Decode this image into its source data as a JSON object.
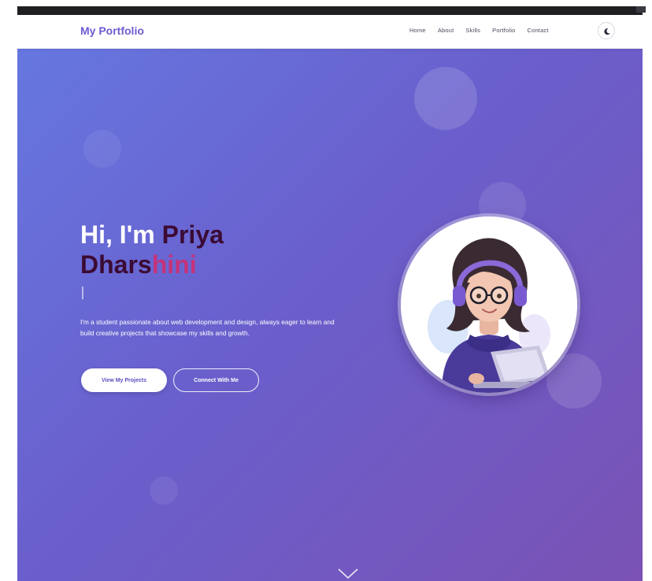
{
  "nav": {
    "brand": "My Portfolio",
    "links": [
      "Home",
      "About",
      "Skills",
      "Portfolio",
      "Contact"
    ],
    "theme_toggle_icon": "moon-icon"
  },
  "hero": {
    "greeting": "Hi, I'm ",
    "name_part1": "Priya",
    "name_part2": "Dhars",
    "name_part3": "hini",
    "description": "I'm a student passionate about web development and design, always eager to learn and build creative projects that showcase my skills and growth.",
    "primary_button": "View My Projects",
    "secondary_button": "Connect With Me",
    "scroll_icon": "chevron-down-icon"
  },
  "colors": {
    "brand": "#6d5bd0",
    "gradient_start": "#6677e0",
    "gradient_end": "#7a52b4",
    "name_dark": "#3b0b33",
    "name_accent": "#c4337a"
  }
}
